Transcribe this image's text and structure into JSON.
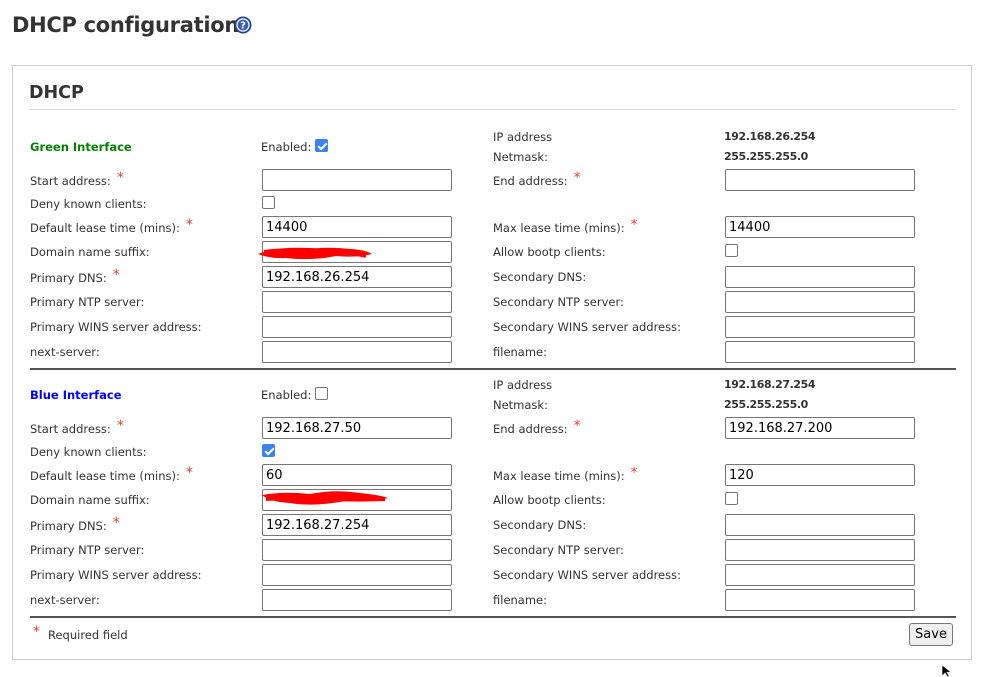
{
  "page": {
    "title": "DHCP configuration"
  },
  "panel": {
    "title": "DHCP"
  },
  "green": {
    "interface_label": "Green Interface",
    "enabled_label": "Enabled:",
    "enabled": true,
    "ip_label": "IP address",
    "ip_value": "192.168.26.254",
    "netmask_label": "Netmask:",
    "netmask_value": "255.255.255.0",
    "start_label": "Start address:",
    "start_value": "",
    "end_label": "End address:",
    "end_value": "",
    "deny_label": "Deny known clients:",
    "deny_checked": false,
    "default_lease_label": "Default lease time (mins):",
    "default_lease_value": "14400",
    "max_lease_label": "Max lease time (mins):",
    "max_lease_value": "14400",
    "domain_label": "Domain name suffix:",
    "domain_value": "",
    "bootp_label": "Allow bootp clients:",
    "bootp_checked": false,
    "dns1_label": "Primary DNS:",
    "dns1_value": "192.168.26.254",
    "dns2_label": "Secondary DNS:",
    "dns2_value": "",
    "ntp1_label": "Primary NTP server:",
    "ntp1_value": "",
    "ntp2_label": "Secondary NTP server:",
    "ntp2_value": "",
    "wins1_label": "Primary WINS server address:",
    "wins1_value": "",
    "wins2_label": "Secondary WINS server address:",
    "wins2_value": "",
    "next_label": "next-server:",
    "next_value": "",
    "filename_label": "filename:",
    "filename_value": ""
  },
  "blue": {
    "interface_label": "Blue Interface",
    "enabled_label": "Enabled:",
    "enabled": false,
    "ip_label": "IP address",
    "ip_value": "192.168.27.254",
    "netmask_label": "Netmask:",
    "netmask_value": "255.255.255.0",
    "start_label": "Start address:",
    "start_value": "192.168.27.50",
    "end_label": "End address:",
    "end_value": "192.168.27.200",
    "deny_label": "Deny known clients:",
    "deny_checked": true,
    "default_lease_label": "Default lease time (mins):",
    "default_lease_value": "60",
    "max_lease_label": "Max lease time (mins):",
    "max_lease_value": "120",
    "domain_label": "Domain name suffix:",
    "domain_value": "",
    "bootp_label": "Allow bootp clients:",
    "bootp_checked": false,
    "dns1_label": "Primary DNS:",
    "dns1_value": "192.168.27.254",
    "dns2_label": "Secondary DNS:",
    "dns2_value": "",
    "ntp1_label": "Primary NTP server:",
    "ntp1_value": "",
    "ntp2_label": "Secondary NTP server:",
    "ntp2_value": "",
    "wins1_label": "Primary WINS server address:",
    "wins1_value": "",
    "wins2_label": "Secondary WINS server address:",
    "wins2_value": "",
    "next_label": "next-server:",
    "next_value": "",
    "filename_label": "filename:",
    "filename_value": ""
  },
  "footer": {
    "required_label": "Required field",
    "save_label": "Save"
  },
  "colors": {
    "green_label": "#008000",
    "blue_label": "#0000ff",
    "required_star": "#e04040",
    "checkbox_checked": "#3b82f6",
    "redaction": "#ff0000"
  },
  "icons": {
    "help": "help-circle-icon",
    "required": "asterisk-icon",
    "cursor": "mouse-pointer-icon"
  }
}
